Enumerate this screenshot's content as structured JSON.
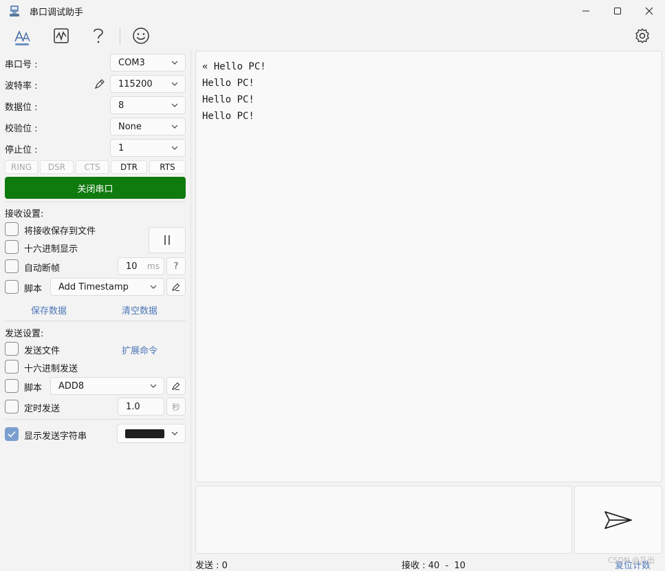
{
  "window": {
    "title": "串口调试助手"
  },
  "serial": {
    "port_label": "串口号 :",
    "port_value": "COM3",
    "baud_label": "波特率 :",
    "baud_value": "115200",
    "databits_label": "数据位 :",
    "databits_value": "8",
    "parity_label": "校验位 :",
    "parity_value": "None",
    "stopbits_label": "停止位 :",
    "stopbits_value": "1",
    "signals": [
      {
        "label": "RING",
        "active": false
      },
      {
        "label": "DSR",
        "active": false
      },
      {
        "label": "CTS",
        "active": false
      },
      {
        "label": "DTR",
        "active": true
      },
      {
        "label": "RTS",
        "active": true
      }
    ],
    "close_button": "关闭串口"
  },
  "receive": {
    "title": "接收设置:",
    "save_to_file": "将接收保存到文件",
    "hex_display": "十六进制显示",
    "auto_frame": "自动断帧",
    "frame_value": "10",
    "frame_unit": "ms",
    "help": "?",
    "script_label": "脚本",
    "script_value": "Add Timestamp",
    "save_data": "保存数据",
    "clear_data": "清空数据"
  },
  "send": {
    "title": "发送设置:",
    "send_file": "发送文件",
    "ext_cmd": "扩展命令",
    "hex_send": "十六进制发送",
    "script_label": "脚本",
    "script_value": "ADD8",
    "timed_send": "定时发送",
    "timed_value": "1.0",
    "timed_unit": "秒",
    "show_string": "显示发送字符串",
    "show_string_checked": true,
    "color_swatch": "#1f1f1f"
  },
  "output": {
    "lines": [
      "« Hello PC!",
      "Hello PC!",
      "Hello PC!",
      "Hello PC!"
    ]
  },
  "status": {
    "sent": "发送 : 0",
    "received": "接收 : 40  -  10",
    "reset": "复位计数"
  },
  "watermark": "CSDN @乃出",
  "colors": {
    "accent": "#7b9ed0",
    "green": "#0f7b0f",
    "link": "#4d78b8"
  }
}
